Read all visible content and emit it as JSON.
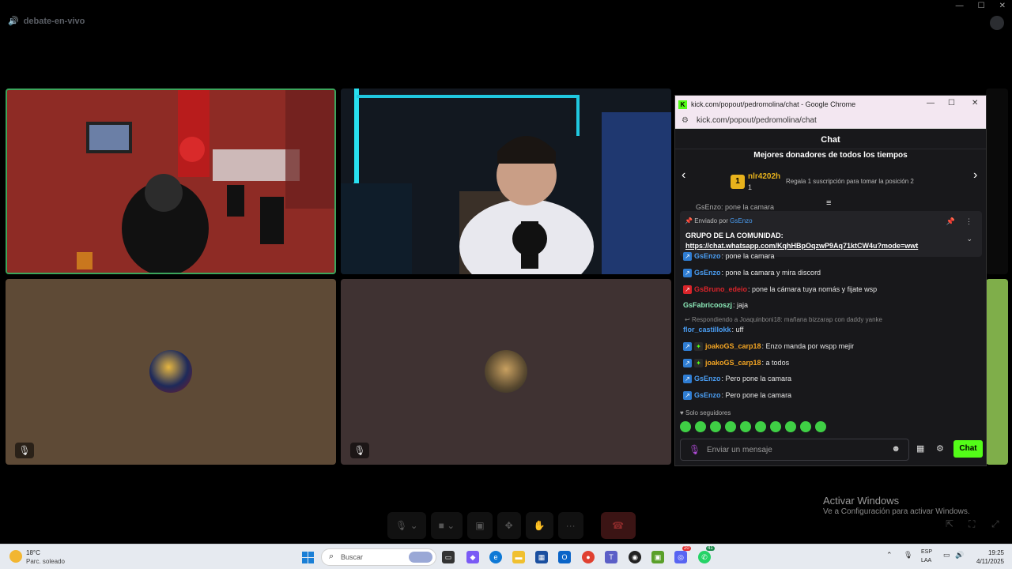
{
  "discord": {
    "channel_name": "debate-en-vivo"
  },
  "popup": {
    "window_title": "kick.com/popout/pedromolina/chat - Google Chrome",
    "url": "kick.com/popout/pedromolina/chat",
    "chat_header": "Chat",
    "donors_title": "Mejores donadores de todos los tiempos",
    "donor_rank": "1",
    "donor_name": "nlr4202h",
    "donor_count": "1",
    "gift_text": "Regala 1 suscripción para tomar la posición 2",
    "partial_msg": "GsEnzo: pone la camara",
    "pinned": {
      "sent_by": "Enviado por",
      "user": "GsEnzo",
      "title": "GRUPO DE LA COMUNIDAD:",
      "link": "https://chat.whatsapp.com/KqhHBpOqzwP9Aq71ktCW4u?mode=wwt"
    },
    "messages": [
      {
        "user": "GsEnzo",
        "text": ": pone la camara"
      },
      {
        "user": "GsEnzo",
        "text": ": pone la camara y mira discord"
      },
      {
        "user": "GsBruno_edeio",
        "text": ": pone la cámara tuya nomás y fijate wsp"
      },
      {
        "user": "GsFabricooszj",
        "text": ": jaja"
      },
      {
        "reply": "Respondiendo a Joaquinboni18: mañana bizzarap con daddy yanke"
      },
      {
        "user": "flor_castillokk",
        "text": ": uff"
      },
      {
        "user": "joakoGS_carp18",
        "text": ": Enzo manda por wspp mejir"
      },
      {
        "user": "joakoGS_carp18",
        "text": ": a todos"
      },
      {
        "user": "GsEnzo",
        "text": ": Pero pone la camara"
      },
      {
        "user": "GsEnzo",
        "text": ": Pero pone la camara"
      }
    ],
    "followers_only": "Solo seguidores",
    "input_placeholder": "Enviar un mensaje",
    "chat_button": "Chat"
  },
  "watermark": {
    "line1": "Activar Windows",
    "line2": "Ve a Configuración para activar Windows."
  },
  "taskbar": {
    "temperature": "18°C",
    "weather": "Parc. soleado",
    "search_label": "Buscar",
    "lang": "ESP",
    "lang2": "LAA",
    "time": "19:25",
    "date": "4/11/2025",
    "discord_badge": "20",
    "whatsapp_badge": "41"
  },
  "colors": {
    "kick_green": "#53fc18",
    "speaking_border": "#3ba55c",
    "chat_bg": "#18181b"
  }
}
